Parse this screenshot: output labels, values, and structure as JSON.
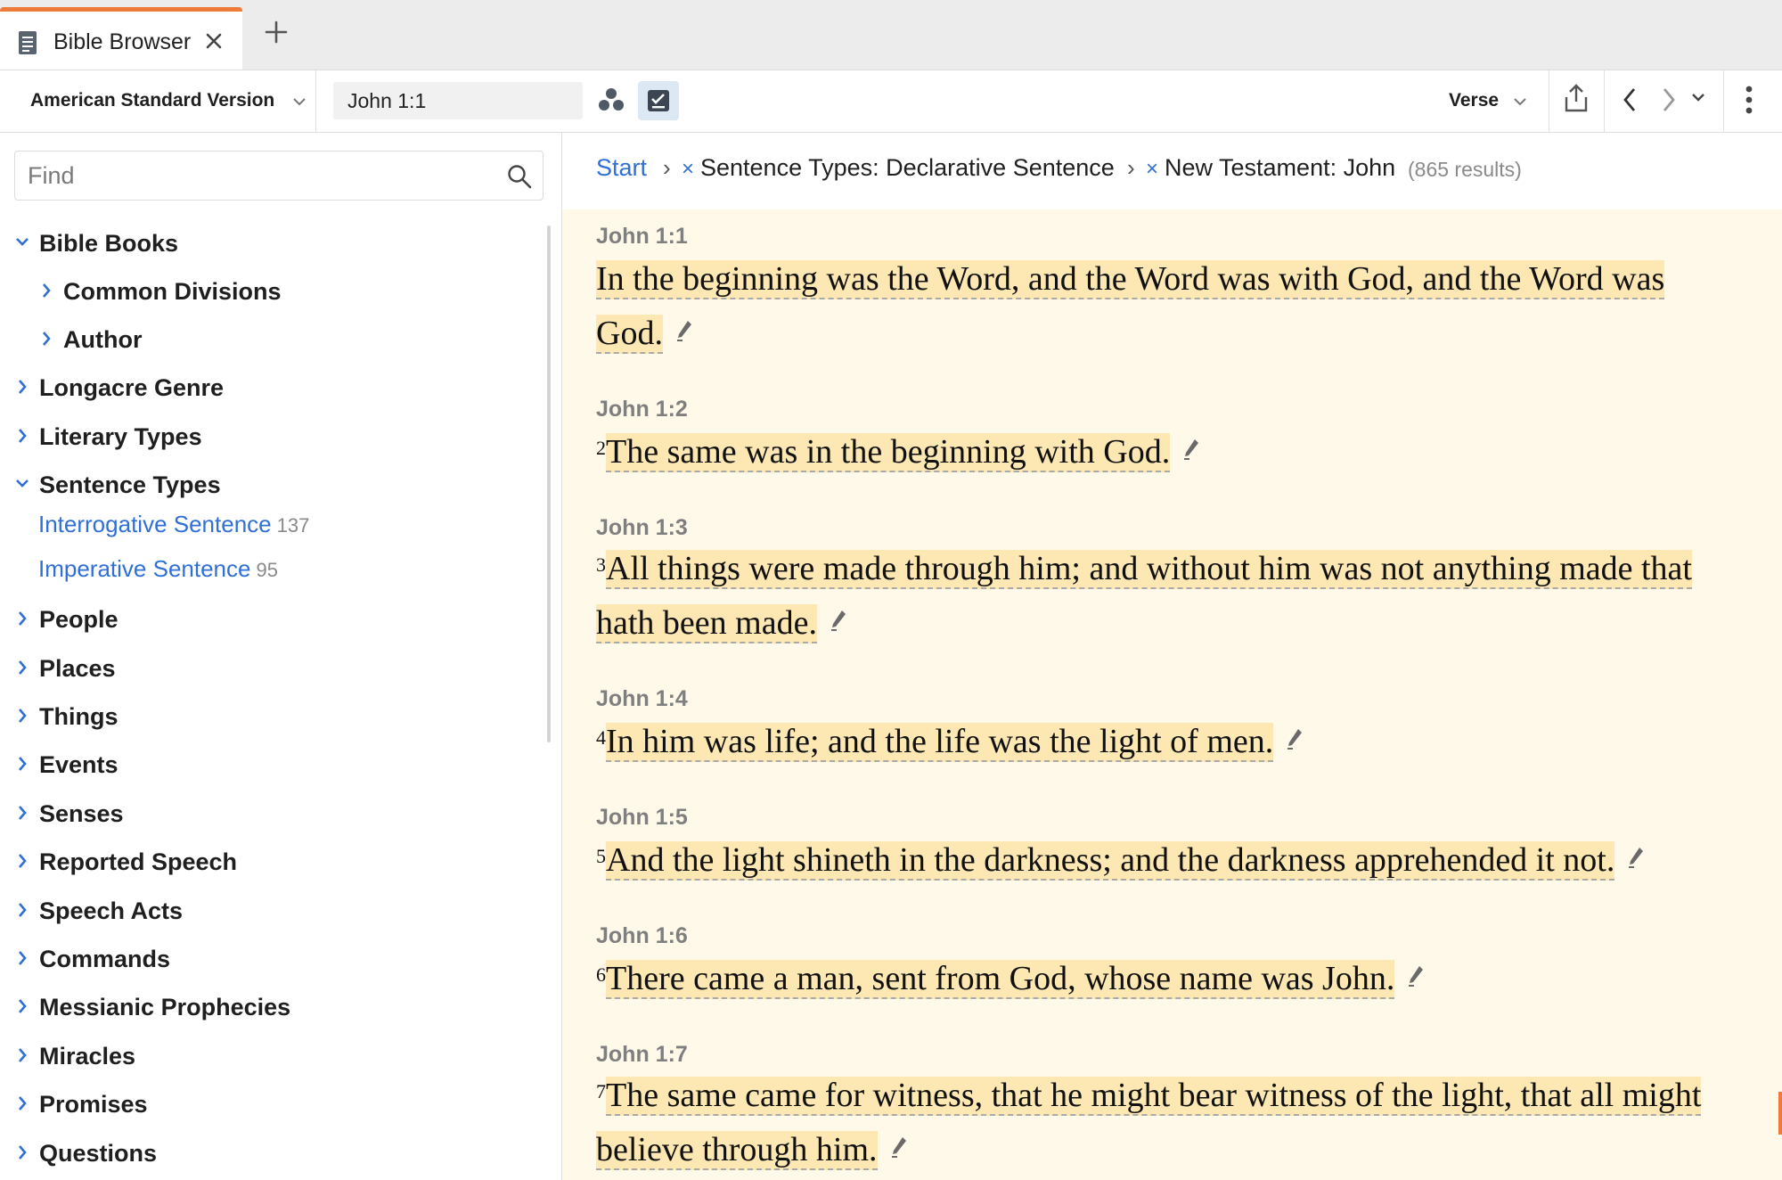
{
  "tab": {
    "title": "Bible Browser"
  },
  "toolbar": {
    "version": "American Standard Version",
    "reference": "John 1:1",
    "view_mode": "Verse"
  },
  "sidebar": {
    "find_placeholder": "Find",
    "tree": [
      {
        "label": "Bible Books",
        "expanded": true
      },
      {
        "label": "Common Divisions",
        "expanded": false,
        "indent": 1
      },
      {
        "label": "Author",
        "expanded": false,
        "indent": 1
      },
      {
        "label": "Longacre Genre",
        "expanded": false
      },
      {
        "label": "Literary Types",
        "expanded": false
      },
      {
        "label": "Sentence Types",
        "expanded": true
      },
      {
        "label": "People",
        "expanded": false
      },
      {
        "label": "Places",
        "expanded": false
      },
      {
        "label": "Things",
        "expanded": false
      },
      {
        "label": "Events",
        "expanded": false
      },
      {
        "label": "Senses",
        "expanded": false
      },
      {
        "label": "Reported Speech",
        "expanded": false
      },
      {
        "label": "Speech Acts",
        "expanded": false
      },
      {
        "label": "Commands",
        "expanded": false
      },
      {
        "label": "Messianic Prophecies",
        "expanded": false
      },
      {
        "label": "Miracles",
        "expanded": false
      },
      {
        "label": "Promises",
        "expanded": false
      },
      {
        "label": "Questions",
        "expanded": false
      }
    ],
    "sentence_types": [
      {
        "label": "Interrogative Sentence",
        "count": "137"
      },
      {
        "label": "Imperative Sentence",
        "count": "95"
      }
    ]
  },
  "breadcrumb": {
    "start": "Start",
    "filter1": "Sentence Types: Declarative Sentence",
    "filter2": "New Testament: John",
    "results": "(865 results)"
  },
  "verses": [
    {
      "ref": "John 1:1",
      "num": "",
      "lines": [
        "In the beginning was the Word, and the Word was with God, and the Word was",
        "God."
      ]
    },
    {
      "ref": "John 1:2",
      "num": "2",
      "lines": [
        "The same was in the beginning with God."
      ]
    },
    {
      "ref": "John 1:3",
      "num": "3",
      "lines": [
        "All things were made through him; and without him was not anything made that",
        "hath been made."
      ]
    },
    {
      "ref": "John 1:4",
      "num": "4",
      "lines": [
        "In him was life; and the life was the light of men."
      ]
    },
    {
      "ref": "John 1:5",
      "num": "5",
      "lines": [
        "And the light shineth in the darkness; and the darkness apprehended it not."
      ]
    },
    {
      "ref": "John 1:6",
      "num": "6",
      "lines": [
        "There came a man, sent from God, whose name was John."
      ]
    },
    {
      "ref": "John 1:7",
      "num": "7",
      "lines": [
        "The same came for witness, that he might bear witness of the light, that all might",
        "believe through him."
      ]
    }
  ],
  "colors": {
    "accent": "#ee7b3a",
    "link": "#2f6fd6",
    "highlight": "#fde7b3",
    "results_bg": "#fff9ea"
  }
}
